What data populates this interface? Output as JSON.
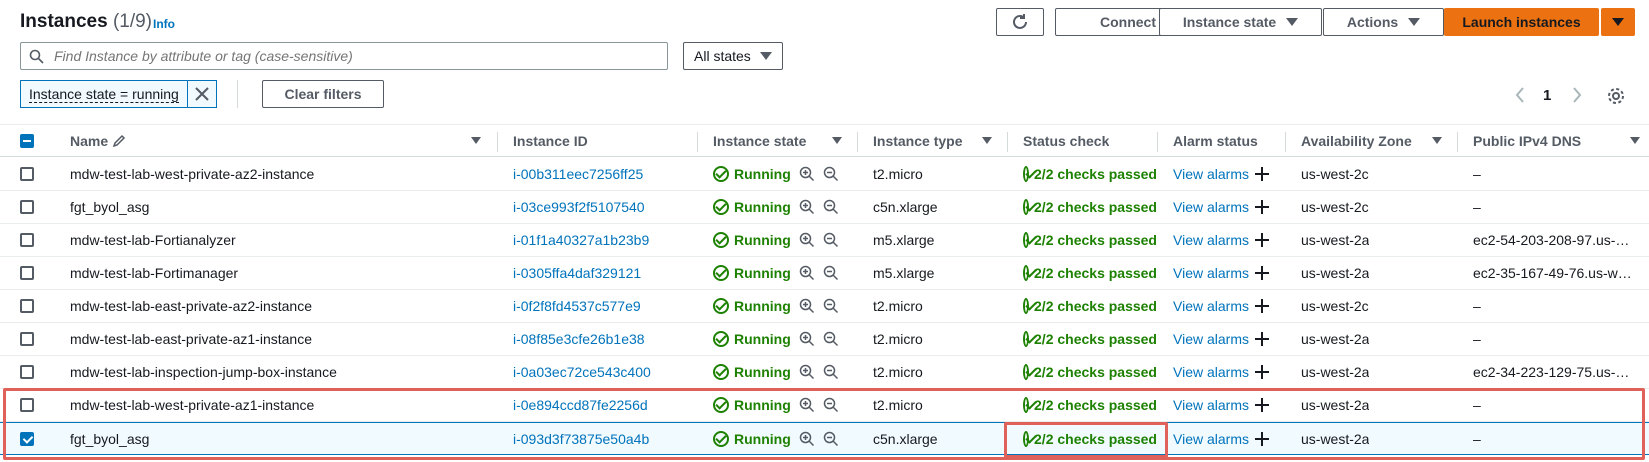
{
  "header": {
    "title": "Instances",
    "count": "(1/9)",
    "info": "Info",
    "refresh_icon": "refresh-icon",
    "connect_label": "Connect",
    "instance_state_label": "Instance state",
    "actions_label": "Actions",
    "launch_label": "Launch instances"
  },
  "search": {
    "placeholder": "Find Instance by attribute or tag (case-sensitive)",
    "value": ""
  },
  "state_filter": {
    "selected": "All states"
  },
  "filters": {
    "token_label": "Instance state = running",
    "clear_label": "Clear filters"
  },
  "pagination": {
    "page": "1"
  },
  "columns": {
    "name": "Name",
    "instance_id": "Instance ID",
    "instance_state": "Instance state",
    "instance_type": "Instance type",
    "status_check": "Status check",
    "alarm_status": "Alarm status",
    "az": "Availability Zone",
    "dns": "Public IPv4 DNS"
  },
  "rows": [
    {
      "name": "mdw-test-lab-west-private-az2-instance",
      "id": "i-00b311eec7256ff25",
      "state": "Running",
      "type": "t2.micro",
      "status": "2/2 checks passed",
      "alarm": "View alarms",
      "az": "us-west-2c",
      "dns": "–",
      "checked": false
    },
    {
      "name": "fgt_byol_asg",
      "id": "i-03ce993f2f5107540",
      "state": "Running",
      "type": "c5n.xlarge",
      "status": "2/2 checks passed",
      "alarm": "View alarms",
      "az": "us-west-2c",
      "dns": "–",
      "checked": false
    },
    {
      "name": "mdw-test-lab-Fortianalyzer",
      "id": "i-01f1a40327a1b23b9",
      "state": "Running",
      "type": "m5.xlarge",
      "status": "2/2 checks passed",
      "alarm": "View alarms",
      "az": "us-west-2a",
      "dns": "ec2-54-203-208-97.us-…",
      "checked": false
    },
    {
      "name": "mdw-test-lab-Fortimanager",
      "id": "i-0305ffa4daf329121",
      "state": "Running",
      "type": "m5.xlarge",
      "status": "2/2 checks passed",
      "alarm": "View alarms",
      "az": "us-west-2a",
      "dns": "ec2-35-167-49-76.us-w…",
      "checked": false
    },
    {
      "name": "mdw-test-lab-east-private-az2-instance",
      "id": "i-0f2f8fd4537c577e9",
      "state": "Running",
      "type": "t2.micro",
      "status": "2/2 checks passed",
      "alarm": "View alarms",
      "az": "us-west-2c",
      "dns": "–",
      "checked": false
    },
    {
      "name": "mdw-test-lab-east-private-az1-instance",
      "id": "i-08f85e3cfe26b1e38",
      "state": "Running",
      "type": "t2.micro",
      "status": "2/2 checks passed",
      "alarm": "View alarms",
      "az": "us-west-2a",
      "dns": "–",
      "checked": false
    },
    {
      "name": "mdw-test-lab-inspection-jump-box-instance",
      "id": "i-0a03ec72ce543c400",
      "state": "Running",
      "type": "t2.micro",
      "status": "2/2 checks passed",
      "alarm": "View alarms",
      "az": "us-west-2a",
      "dns": "ec2-34-223-129-75.us-…",
      "checked": false
    },
    {
      "name": "mdw-test-lab-west-private-az1-instance",
      "id": "i-0e894ccd87fe2256d",
      "state": "Running",
      "type": "t2.micro",
      "status": "2/2 checks passed",
      "alarm": "View alarms",
      "az": "us-west-2a",
      "dns": "–",
      "checked": false
    },
    {
      "name": "fgt_byol_asg",
      "id": "i-093d3f73875e50a4b",
      "state": "Running",
      "type": "c5n.xlarge",
      "status": "2/2 checks passed",
      "alarm": "View alarms",
      "az": "us-west-2a",
      "dns": "–",
      "checked": true
    }
  ],
  "colors": {
    "accent": "#0073bb",
    "primary": "#ec7211",
    "success": "#1d8102",
    "highlight": "#e0605a"
  }
}
